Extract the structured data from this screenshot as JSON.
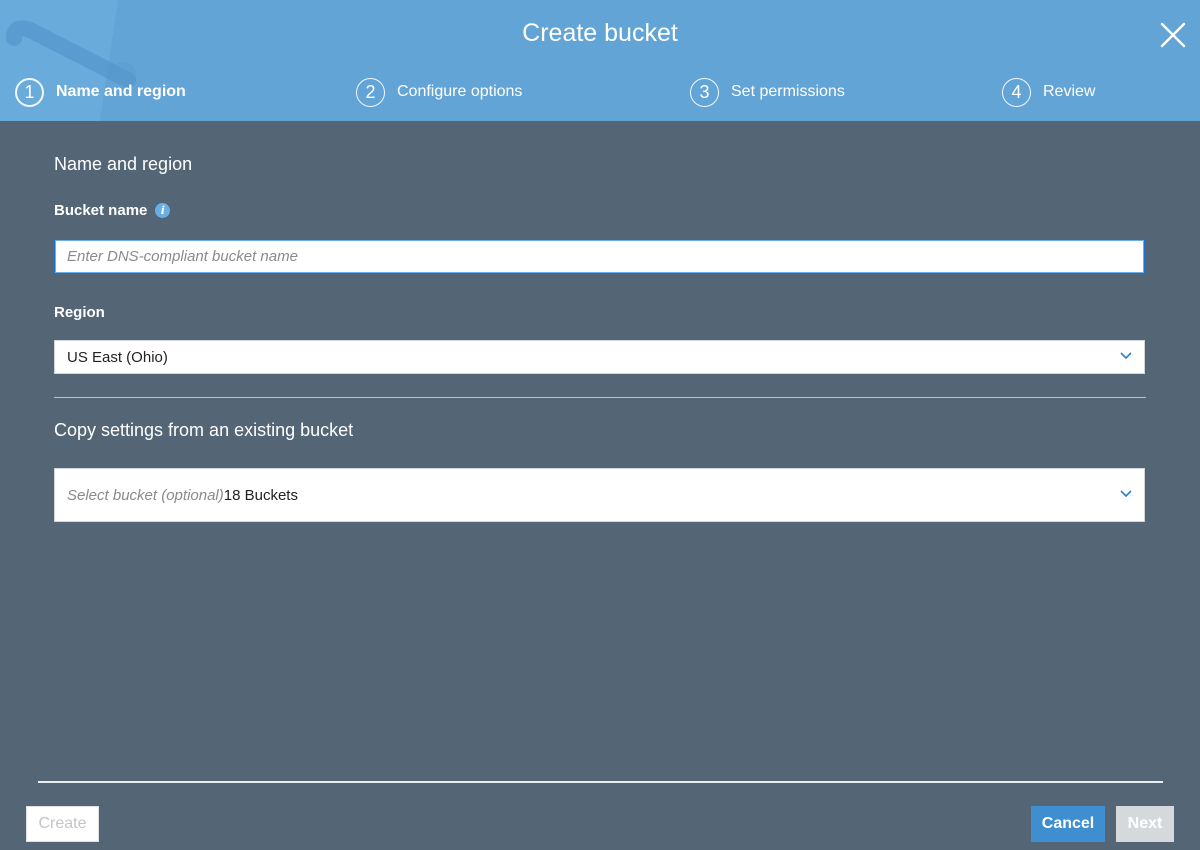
{
  "header": {
    "title": "Create bucket",
    "steps": [
      {
        "number": "1",
        "label": "Name and region",
        "active": true
      },
      {
        "number": "2",
        "label": "Configure options",
        "active": false
      },
      {
        "number": "3",
        "label": "Set permissions",
        "active": false
      },
      {
        "number": "4",
        "label": "Review",
        "active": false
      }
    ]
  },
  "form": {
    "section_title": "Name and region",
    "bucket_name": {
      "label": "Bucket name",
      "placeholder": "Enter DNS-compliant bucket name",
      "value": ""
    },
    "region": {
      "label": "Region",
      "selected": "US East (Ohio)"
    },
    "copy_settings": {
      "title": "Copy settings from an existing bucket",
      "placeholder": "Select bucket (optional)",
      "count": "18 Buckets"
    }
  },
  "footer": {
    "create_label": "Create",
    "cancel_label": "Cancel",
    "next_label": "Next"
  },
  "colors": {
    "header_bg": "#63a4d6",
    "body_bg": "#546575",
    "primary_button": "#3f8fd0",
    "disabled_button": "#d6d9dc"
  },
  "icons": [
    "close-icon",
    "info-icon",
    "chevron-down-icon"
  ]
}
